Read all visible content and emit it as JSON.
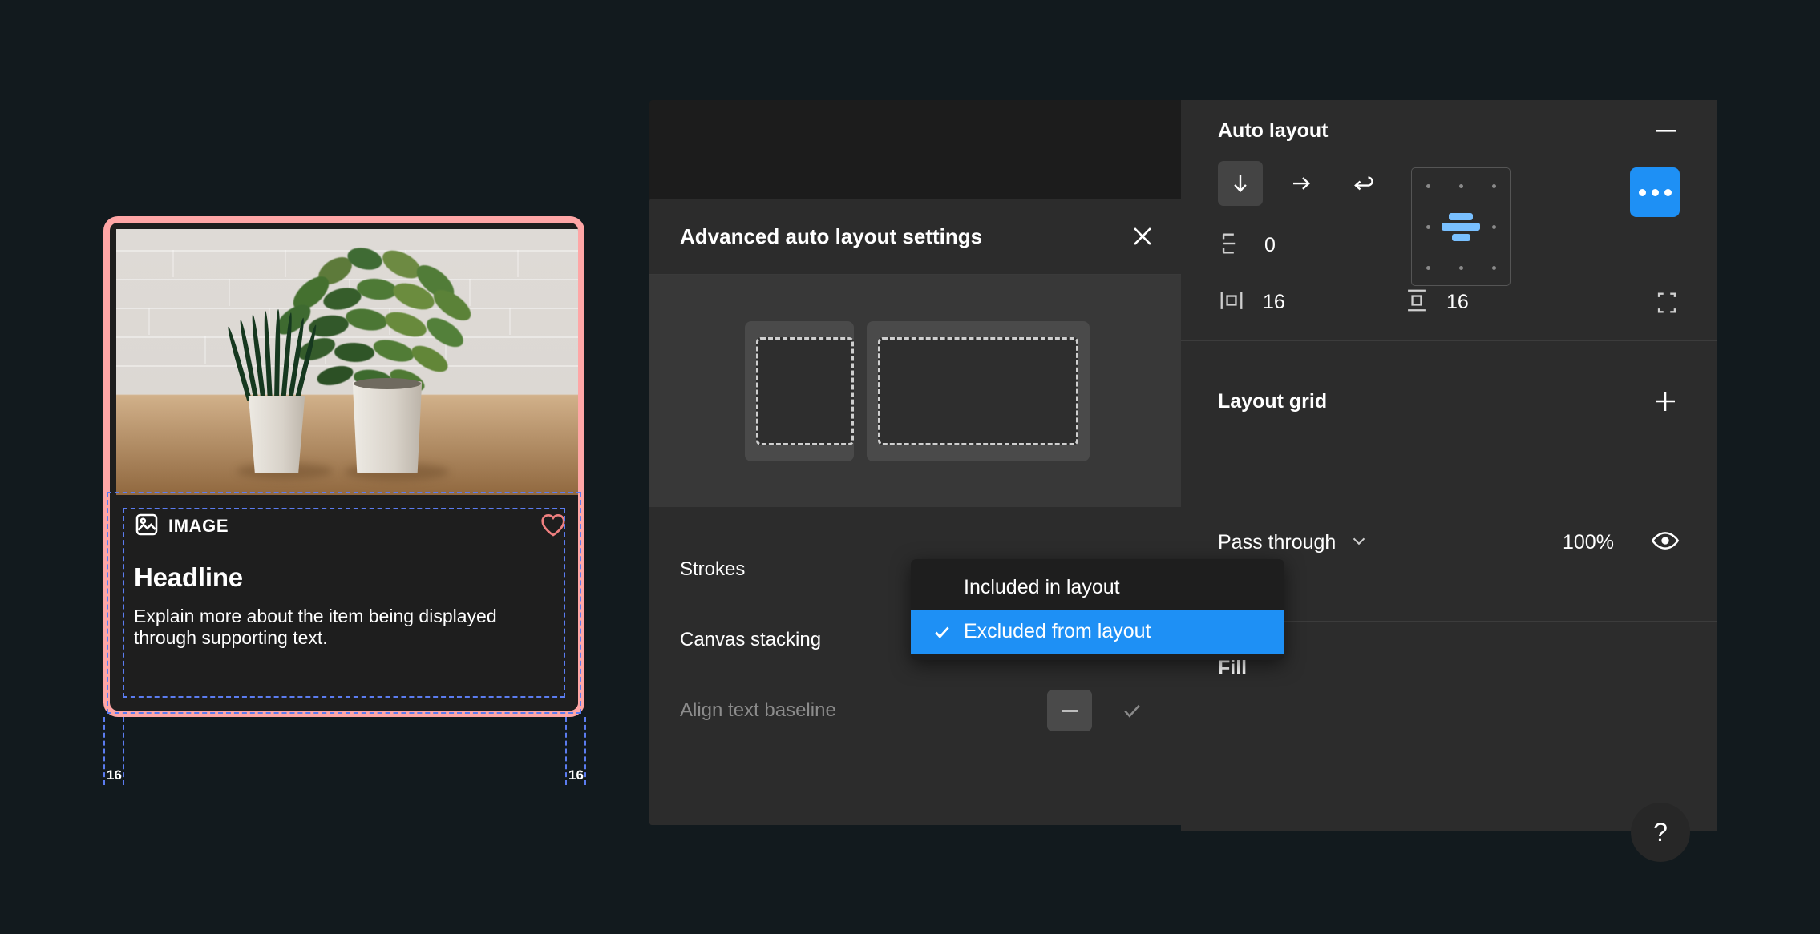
{
  "canvas": {
    "card": {
      "image_label": "IMAGE",
      "image_icon": "picture-icon",
      "favorite_icon": "heart-outline-icon",
      "headline": "Headline",
      "supporting_text": "Explain more about the item being displayed through supporting text.",
      "padding_left_label": "16",
      "padding_right_label": "16",
      "selection_color": "#ffa6a6",
      "guide_color": "#5b7cf0"
    }
  },
  "modal": {
    "title": "Advanced auto layout settings",
    "close_icon": "close-icon",
    "rows": [
      {
        "label": "Strokes",
        "disabled": false
      },
      {
        "label": "Canvas stacking",
        "disabled": false
      },
      {
        "label": "Align text baseline",
        "disabled": true
      }
    ],
    "baseline_options": {
      "dash_label": "-",
      "check_icon": "check-icon"
    }
  },
  "dropdown": {
    "items": [
      {
        "label": "Included in layout",
        "selected": false
      },
      {
        "label": "Excluded from layout",
        "selected": true
      }
    ],
    "highlight_color": "#1e90f5",
    "check_icon": "check-icon"
  },
  "panel": {
    "auto_layout": {
      "title": "Auto layout",
      "minimize_icon": "minus-icon",
      "directions": [
        {
          "name": "vertical",
          "icon": "arrow-down-icon",
          "active": true
        },
        {
          "name": "horizontal",
          "icon": "arrow-right-icon",
          "active": false
        },
        {
          "name": "wrap",
          "icon": "wrap-arrow-icon",
          "active": false
        }
      ],
      "gap_icon": "gap-vertical-icon",
      "gap_value": "0",
      "horizontal_padding_icon": "horizontal-padding-icon",
      "horizontal_padding_value": "16",
      "vertical_padding_icon": "vertical-padding-icon",
      "vertical_padding_value": "16",
      "individual_padding_icon": "individual-padding-icon",
      "alignment_icon": "alignment-grid-center",
      "more_icon": "more-options-icon",
      "more_color": "#1e90f5"
    },
    "layout_grid": {
      "title": "Layout grid",
      "add_icon": "plus-icon"
    },
    "blend": {
      "mode": "Pass through",
      "chevron_icon": "chevron-down-icon",
      "opacity": "100%",
      "visibility_icon": "eye-icon"
    },
    "fill": {
      "title": "Fill"
    },
    "help": {
      "label": "?",
      "icon": "help-icon"
    }
  }
}
